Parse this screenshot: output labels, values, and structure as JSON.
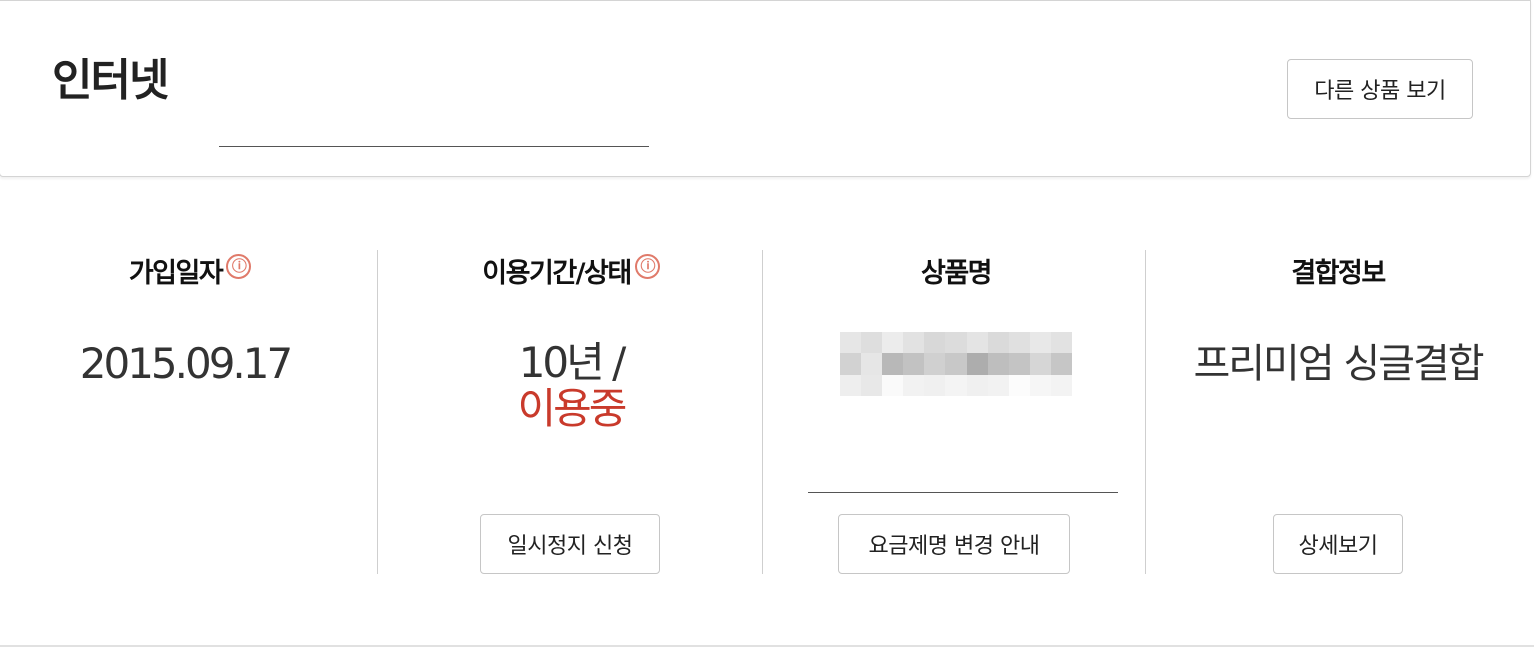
{
  "header": {
    "title": "인터넷",
    "other_products_button": "다른 상품 보기"
  },
  "columns": [
    {
      "heading": "가입일자",
      "has_info_icon": true,
      "value": "2015.09.17"
    },
    {
      "heading": "이용기간/상태",
      "has_info_icon": true,
      "value_period": "10년 /",
      "value_status": "이용중",
      "status_color": "#c93a2b",
      "button": "일시정지 신청"
    },
    {
      "heading": "상품명",
      "has_info_icon": false,
      "value": "",
      "value_obscured": true,
      "button": "요금제명 변경 안내"
    },
    {
      "heading": "결합정보",
      "has_info_icon": false,
      "value": "프리미엄 싱글결합",
      "button": "상세보기"
    }
  ],
  "icons": {
    "info": "ⓘ"
  },
  "colors": {
    "accent_red": "#c93a2b",
    "info_icon": "#e07a6a",
    "border": "#c6c6c6"
  }
}
